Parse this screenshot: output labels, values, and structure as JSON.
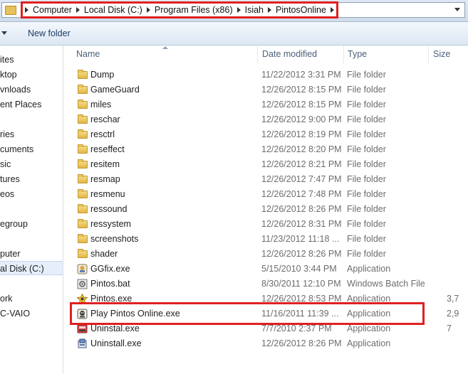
{
  "address_bar": {
    "crumbs": [
      "Computer",
      "Local Disk (C:)",
      "Program Files (x86)",
      "Isiah",
      "PintosOnline"
    ]
  },
  "toolbar": {
    "new_folder_label": "New folder"
  },
  "nav_pane": {
    "items": [
      "ites",
      "ktop",
      "vnloads",
      "ent Places",
      "ries",
      "cuments",
      "sic",
      "tures",
      "eos",
      "egroup",
      "puter",
      "al Disk (C:)",
      "ork",
      "C-VAIO"
    ]
  },
  "columns": {
    "name": "Name",
    "date_modified": "Date modified",
    "type": "Type",
    "size": "Size"
  },
  "files": [
    {
      "name": "Dump",
      "date": "11/22/2012 3:31 PM",
      "type": "File folder",
      "size": "",
      "icon": "folder-icon"
    },
    {
      "name": "GameGuard",
      "date": "12/26/2012 8:15 PM",
      "type": "File folder",
      "size": "",
      "icon": "folder-icon"
    },
    {
      "name": "miles",
      "date": "12/26/2012 8:15 PM",
      "type": "File folder",
      "size": "",
      "icon": "folder-icon"
    },
    {
      "name": "reschar",
      "date": "12/26/2012 9:00 PM",
      "type": "File folder",
      "size": "",
      "icon": "folder-icon"
    },
    {
      "name": "resctrl",
      "date": "12/26/2012 8:19 PM",
      "type": "File folder",
      "size": "",
      "icon": "folder-icon"
    },
    {
      "name": "reseffect",
      "date": "12/26/2012 8:20 PM",
      "type": "File folder",
      "size": "",
      "icon": "folder-icon"
    },
    {
      "name": "resitem",
      "date": "12/26/2012 8:21 PM",
      "type": "File folder",
      "size": "",
      "icon": "folder-icon"
    },
    {
      "name": "resmap",
      "date": "12/26/2012 7:47 PM",
      "type": "File folder",
      "size": "",
      "icon": "folder-icon"
    },
    {
      "name": "resmenu",
      "date": "12/26/2012 7:48 PM",
      "type": "File folder",
      "size": "",
      "icon": "folder-icon"
    },
    {
      "name": "ressound",
      "date": "12/26/2012 8:26 PM",
      "type": "File folder",
      "size": "",
      "icon": "folder-icon"
    },
    {
      "name": "ressystem",
      "date": "12/26/2012 8:31 PM",
      "type": "File folder",
      "size": "",
      "icon": "folder-icon"
    },
    {
      "name": "screenshots",
      "date": "11/23/2012 11:18 ...",
      "type": "File folder",
      "size": "",
      "icon": "folder-icon"
    },
    {
      "name": "shader",
      "date": "12/26/2012 8:26 PM",
      "type": "File folder",
      "size": "",
      "icon": "folder-icon"
    },
    {
      "name": "GGfix.exe",
      "date": "5/15/2010 3:44 PM",
      "type": "Application",
      "size": "",
      "icon": "ggfix-app-icon"
    },
    {
      "name": "Pintos.bat",
      "date": "8/30/2011 12:10 PM",
      "type": "Windows Batch File",
      "size": "",
      "icon": "batch-file-icon"
    },
    {
      "name": "Pintos.exe",
      "date": "12/26/2012 8:53 PM",
      "type": "Application",
      "size": "3,7",
      "icon": "pintos-app-icon"
    },
    {
      "name": "Play Pintos Online.exe",
      "date": "11/16/2011 11:39 ...",
      "type": "Application",
      "size": "2,9",
      "icon": "pintos-launcher-icon"
    },
    {
      "name": "Uninstal.exe",
      "date": "7/7/2010 2:37 PM",
      "type": "Application",
      "size": "7",
      "icon": "uninstaller-icon"
    },
    {
      "name": "Uninstall.exe",
      "date": "12/26/2012 8:26 PM",
      "type": "Application",
      "size": "",
      "icon": "uninstall-setup-icon"
    }
  ],
  "colors": {
    "highlight": "#e02020",
    "folder": "#e3b646",
    "header_text": "#4c607a"
  }
}
